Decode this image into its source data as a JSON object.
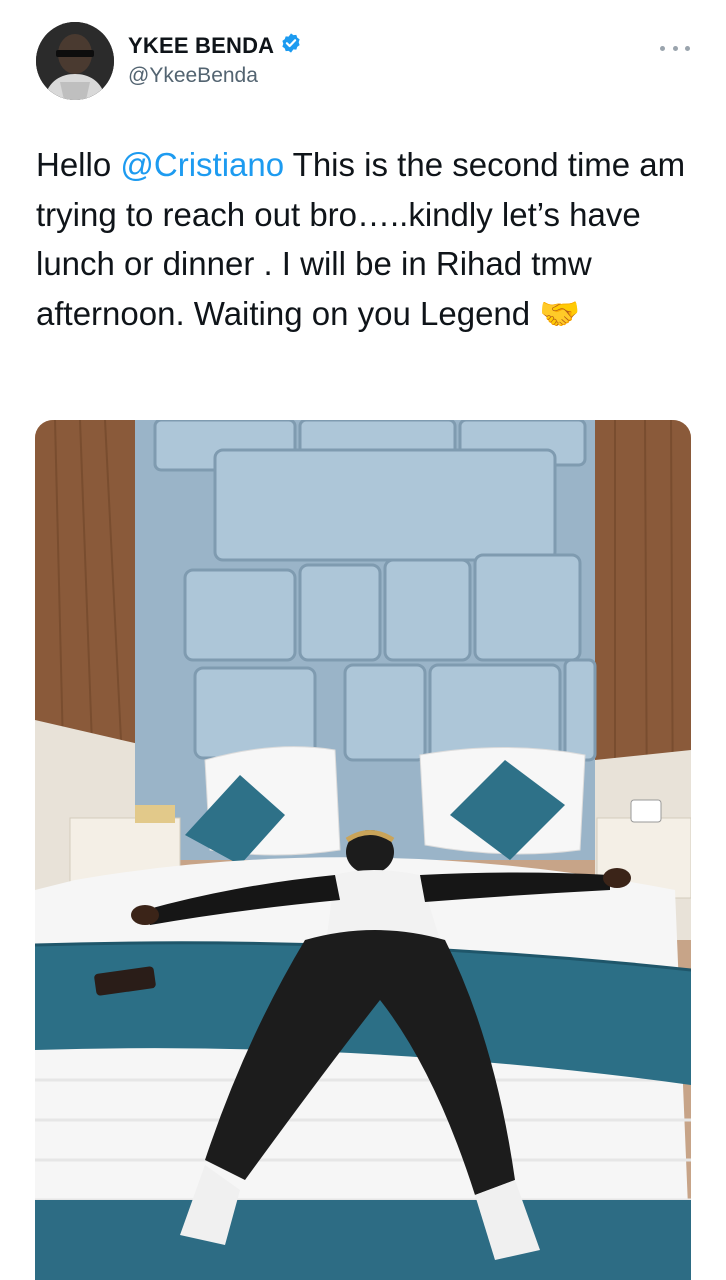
{
  "author": {
    "display_name": "YKEE BENDA",
    "handle": "@YkeeBenda",
    "verified": true,
    "avatar_icon": "profile-photo"
  },
  "tweet": {
    "text_before_mention": "Hello ",
    "mention": "@Cristiano",
    "text_after_mention": " This is the second time am trying to reach out bro…..kindly let’s have lunch or dinner . I will be in Rihad tmw afternoon. Waiting on you Legend ",
    "emoji": "🤝"
  },
  "media": {
    "kind": "photo",
    "icon": "photo-man-on-hotel-bed"
  },
  "colors": {
    "mention": "#1d9bf0",
    "verified_badge": "#1d9bf0",
    "handle": "#536471"
  }
}
